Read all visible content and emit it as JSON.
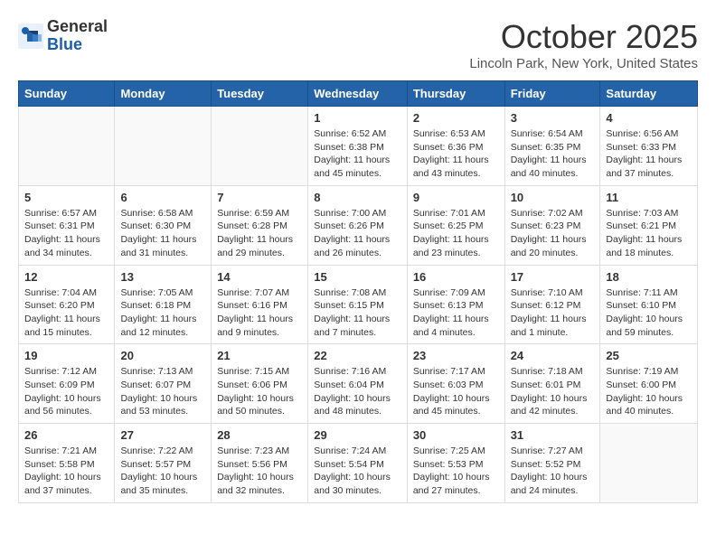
{
  "header": {
    "logo_general": "General",
    "logo_blue": "Blue",
    "month_title": "October 2025",
    "location": "Lincoln Park, New York, United States"
  },
  "days_of_week": [
    "Sunday",
    "Monday",
    "Tuesday",
    "Wednesday",
    "Thursday",
    "Friday",
    "Saturday"
  ],
  "weeks": [
    {
      "days": [
        {
          "num": "",
          "content": ""
        },
        {
          "num": "",
          "content": ""
        },
        {
          "num": "",
          "content": ""
        },
        {
          "num": "1",
          "content": "Sunrise: 6:52 AM\nSunset: 6:38 PM\nDaylight: 11 hours and 45 minutes."
        },
        {
          "num": "2",
          "content": "Sunrise: 6:53 AM\nSunset: 6:36 PM\nDaylight: 11 hours and 43 minutes."
        },
        {
          "num": "3",
          "content": "Sunrise: 6:54 AM\nSunset: 6:35 PM\nDaylight: 11 hours and 40 minutes."
        },
        {
          "num": "4",
          "content": "Sunrise: 6:56 AM\nSunset: 6:33 PM\nDaylight: 11 hours and 37 minutes."
        }
      ]
    },
    {
      "days": [
        {
          "num": "5",
          "content": "Sunrise: 6:57 AM\nSunset: 6:31 PM\nDaylight: 11 hours and 34 minutes."
        },
        {
          "num": "6",
          "content": "Sunrise: 6:58 AM\nSunset: 6:30 PM\nDaylight: 11 hours and 31 minutes."
        },
        {
          "num": "7",
          "content": "Sunrise: 6:59 AM\nSunset: 6:28 PM\nDaylight: 11 hours and 29 minutes."
        },
        {
          "num": "8",
          "content": "Sunrise: 7:00 AM\nSunset: 6:26 PM\nDaylight: 11 hours and 26 minutes."
        },
        {
          "num": "9",
          "content": "Sunrise: 7:01 AM\nSunset: 6:25 PM\nDaylight: 11 hours and 23 minutes."
        },
        {
          "num": "10",
          "content": "Sunrise: 7:02 AM\nSunset: 6:23 PM\nDaylight: 11 hours and 20 minutes."
        },
        {
          "num": "11",
          "content": "Sunrise: 7:03 AM\nSunset: 6:21 PM\nDaylight: 11 hours and 18 minutes."
        }
      ]
    },
    {
      "days": [
        {
          "num": "12",
          "content": "Sunrise: 7:04 AM\nSunset: 6:20 PM\nDaylight: 11 hours and 15 minutes."
        },
        {
          "num": "13",
          "content": "Sunrise: 7:05 AM\nSunset: 6:18 PM\nDaylight: 11 hours and 12 minutes."
        },
        {
          "num": "14",
          "content": "Sunrise: 7:07 AM\nSunset: 6:16 PM\nDaylight: 11 hours and 9 minutes."
        },
        {
          "num": "15",
          "content": "Sunrise: 7:08 AM\nSunset: 6:15 PM\nDaylight: 11 hours and 7 minutes."
        },
        {
          "num": "16",
          "content": "Sunrise: 7:09 AM\nSunset: 6:13 PM\nDaylight: 11 hours and 4 minutes."
        },
        {
          "num": "17",
          "content": "Sunrise: 7:10 AM\nSunset: 6:12 PM\nDaylight: 11 hours and 1 minute."
        },
        {
          "num": "18",
          "content": "Sunrise: 7:11 AM\nSunset: 6:10 PM\nDaylight: 10 hours and 59 minutes."
        }
      ]
    },
    {
      "days": [
        {
          "num": "19",
          "content": "Sunrise: 7:12 AM\nSunset: 6:09 PM\nDaylight: 10 hours and 56 minutes."
        },
        {
          "num": "20",
          "content": "Sunrise: 7:13 AM\nSunset: 6:07 PM\nDaylight: 10 hours and 53 minutes."
        },
        {
          "num": "21",
          "content": "Sunrise: 7:15 AM\nSunset: 6:06 PM\nDaylight: 10 hours and 50 minutes."
        },
        {
          "num": "22",
          "content": "Sunrise: 7:16 AM\nSunset: 6:04 PM\nDaylight: 10 hours and 48 minutes."
        },
        {
          "num": "23",
          "content": "Sunrise: 7:17 AM\nSunset: 6:03 PM\nDaylight: 10 hours and 45 minutes."
        },
        {
          "num": "24",
          "content": "Sunrise: 7:18 AM\nSunset: 6:01 PM\nDaylight: 10 hours and 42 minutes."
        },
        {
          "num": "25",
          "content": "Sunrise: 7:19 AM\nSunset: 6:00 PM\nDaylight: 10 hours and 40 minutes."
        }
      ]
    },
    {
      "days": [
        {
          "num": "26",
          "content": "Sunrise: 7:21 AM\nSunset: 5:58 PM\nDaylight: 10 hours and 37 minutes."
        },
        {
          "num": "27",
          "content": "Sunrise: 7:22 AM\nSunset: 5:57 PM\nDaylight: 10 hours and 35 minutes."
        },
        {
          "num": "28",
          "content": "Sunrise: 7:23 AM\nSunset: 5:56 PM\nDaylight: 10 hours and 32 minutes."
        },
        {
          "num": "29",
          "content": "Sunrise: 7:24 AM\nSunset: 5:54 PM\nDaylight: 10 hours and 30 minutes."
        },
        {
          "num": "30",
          "content": "Sunrise: 7:25 AM\nSunset: 5:53 PM\nDaylight: 10 hours and 27 minutes."
        },
        {
          "num": "31",
          "content": "Sunrise: 7:27 AM\nSunset: 5:52 PM\nDaylight: 10 hours and 24 minutes."
        },
        {
          "num": "",
          "content": ""
        }
      ]
    }
  ]
}
